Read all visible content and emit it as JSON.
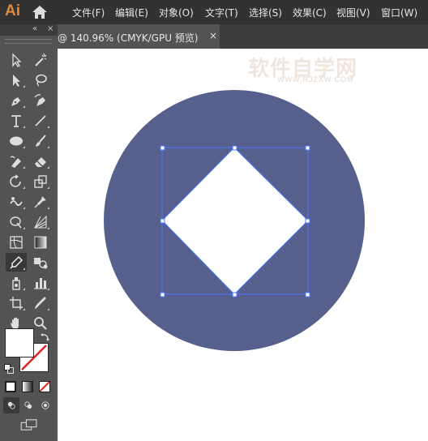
{
  "app": {
    "logo": "Ai"
  },
  "menu": [
    "文件(F)",
    "编辑(E)",
    "对象(O)",
    "文字(T)",
    "选择(S)",
    "效果(C)",
    "视图(V)",
    "窗口(W)"
  ],
  "document_tab": {
    "title": "@ 140.96% (CMYK/GPU 预览)",
    "close": "×"
  },
  "watermark": {
    "main": "软件自学网",
    "sub": "WWW.RJZXW.COM"
  },
  "toolbar": {
    "collapse": "«",
    "close": "×"
  },
  "artwork": {
    "circle_color": "#57608c",
    "diamond_color": "#ffffff",
    "selection_color": "#4a78ff"
  },
  "swatches": {
    "fill": "#ffffff",
    "stroke": "none"
  }
}
